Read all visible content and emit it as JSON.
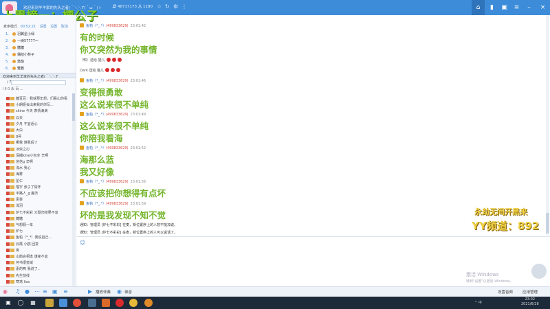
{
  "titlebar": {
    "left_text": "欢迎来到羊羊家的先头之者(＾＼＼ϒ(＾ω＾)ゝ",
    "room_id": "48717173",
    "count": "1180",
    "right_icons": [
      "home-icon",
      "game-icon",
      "lock-icon",
      "more-icon",
      "minimize-icon",
      "maximize-icon",
      "close-icon"
    ],
    "accent": "#3d8cd9"
  },
  "overlay": {
    "title": "上周榜一：梗公子",
    "side_line1": "永劫无间开黑来",
    "side_line2": "YY频道：892"
  },
  "leftpanel": {
    "mode": "麦序模式",
    "timer": "00:52:21",
    "links": [
      "设置",
      "设置",
      "取消"
    ],
    "queue": [
      {
        "num": "1.",
        "name": "羽翼星小绿"
      },
      {
        "num": "2.",
        "name": "一树57777～"
      },
      {
        "num": "3.",
        "name": "糖糖"
      },
      {
        "num": "4.",
        "name": "偶结小林子"
      },
      {
        "num": "5.",
        "name": "悠悠"
      },
      {
        "num": "6.",
        "name": "雅雅"
      }
    ],
    "channel_header": "欢迎来到羊羊家的先头之者(＾＼＼ϒ",
    "channel_header2": "/ 7 ...",
    "toolbar": "Ⅰ Ⅱ 0 永 百 ...",
    "users": [
      "糖豆豆：我就那年想，们看山你看",
      "小朗姬会出来我的你写...",
      "skine 今天 表情滴滴",
      "云夫",
      "夕舟  不宜话心",
      "大白",
      "g哥",
      "哪我  谁我后了",
      "冰依之刃",
      "深撮kine小包全  辛啊",
      "信信g  辛啊",
      "浅水  我心",
      "海雾",
      "星仁",
      "喵宇  张子了情怀",
      "半路人_g  魔法",
      "思雯",
      "浅羽",
      "炉七不彩彩  大题归结果不宜",
      "糖糖",
      "气想假一年",
      "炉七",
      "鱼帕（*_*）我说自己...",
      "云霞 小鸥  回复",
      "离",
      "山鹊会相逢  谦卑不宜",
      "何书很蛮域",
      "素的鸭  我说了..",
      "先生前线",
      "寒鸢  lisa"
    ]
  },
  "chat": {
    "messages": [
      {
        "type": "meta",
        "name": "鱼帕（*_.*）",
        "uid": "(499833629)",
        "time": "23:01:42"
      },
      {
        "type": "msg",
        "text": "有的时候"
      },
      {
        "type": "msg",
        "text": "你又突然为我的事情"
      },
      {
        "type": "misc",
        "text": "（鸭）送给 猫儿"
      },
      {
        "type": "misc",
        "text": "Dark 送给 猫儿"
      },
      {
        "type": "meta",
        "name": "鱼帕（*_.*）",
        "uid": "(499833629)",
        "time": "23:01:46"
      },
      {
        "type": "msg",
        "text": "变得很勇敢"
      },
      {
        "type": "msg",
        "text": "这么说来很不单纯"
      },
      {
        "type": "meta",
        "name": "鱼帕（*_.*）",
        "uid": "(499833629)",
        "time": "23:01:49"
      },
      {
        "type": "msg",
        "text": "这么说来很不单纯"
      },
      {
        "type": "msg",
        "text": "你陪我看海"
      },
      {
        "type": "meta",
        "name": "鱼帕（*_.*）",
        "uid": "(499833629)",
        "time": "23:01:52"
      },
      {
        "type": "msg",
        "text": "海那么蓝"
      },
      {
        "type": "msg",
        "text": "我又好像"
      },
      {
        "type": "meta",
        "name": "鱼帕（*_.*）",
        "uid": "(499833629)",
        "time": "23:01:56"
      },
      {
        "type": "msg",
        "text": "不应该把你想得有点坏"
      },
      {
        "type": "meta",
        "name": "鱼帕（*_.*）",
        "uid": "(499833629)",
        "time": "23:01:59"
      },
      {
        "type": "msg",
        "text": "坏的是我发现不知不觉"
      }
    ],
    "notices": [
      "通知：管理员 [炉七不彩彩] 在麦，新位置序上的人暂不能加说。",
      "通知：管理员 [炉七不彩彩] 在麦，新位置序上的人可以说话了。"
    ]
  },
  "input": {
    "windows_activation1": "激活 Windows",
    "windows_activation2": "转到\"设置\"以激活 Windows。"
  },
  "bottombar": {
    "items": [
      "播放伴奏",
      "录音"
    ],
    "right_items": [
      "设置音频",
      "应用管理"
    ]
  },
  "taskbar": {
    "time": "23:02",
    "date": "2021/6/28",
    "tray_text": "^ 中"
  }
}
